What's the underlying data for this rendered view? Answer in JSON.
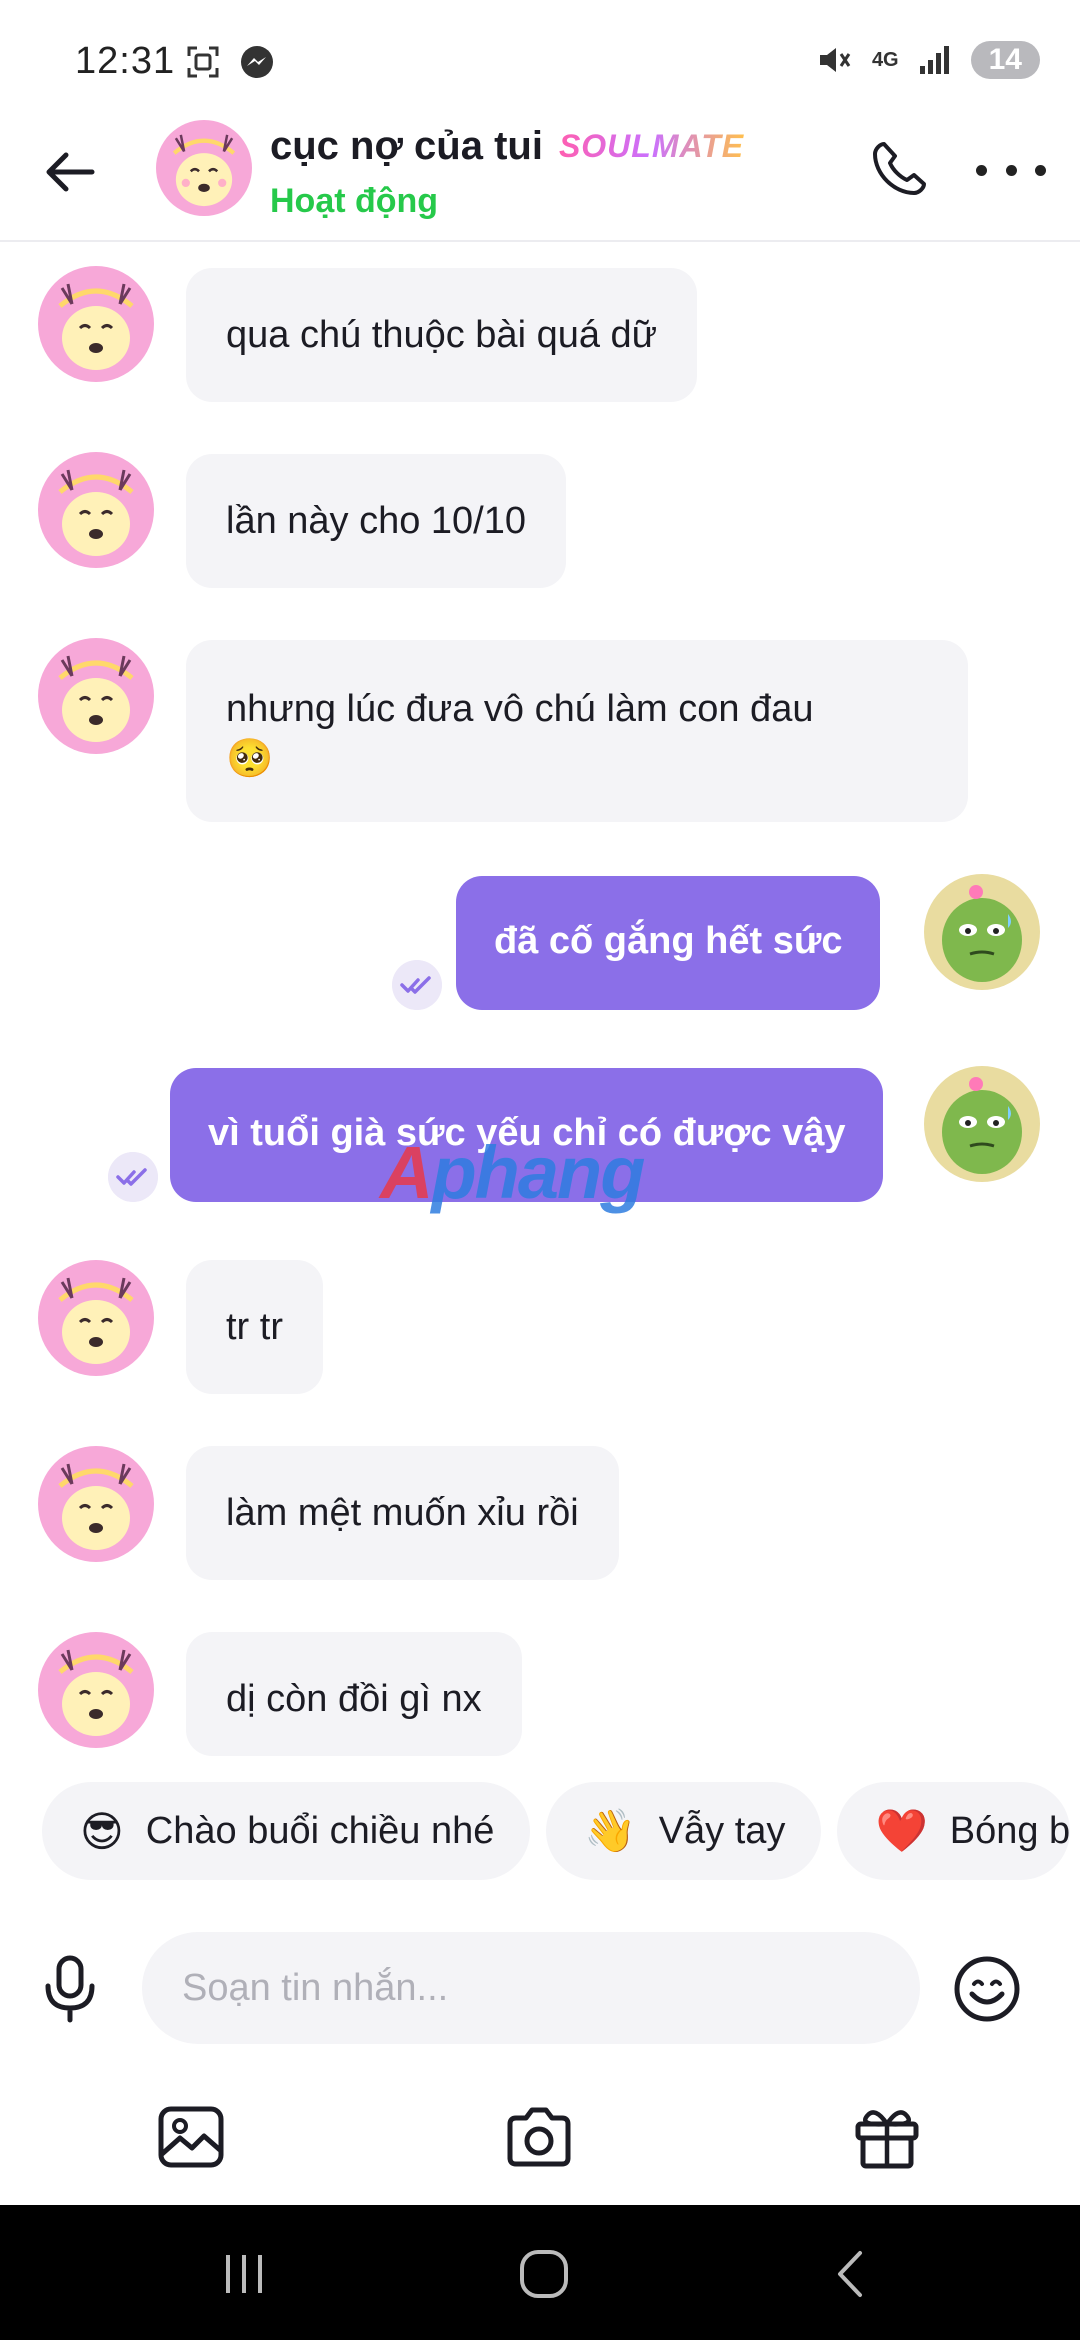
{
  "status_bar": {
    "time": "12:31",
    "network": "4G",
    "battery": "14"
  },
  "header": {
    "name": "cục nợ của tui",
    "tag": "SOULMATE",
    "status": "Hoạt động"
  },
  "messages": [
    {
      "direction": "in",
      "text": "qua chú thuộc bài quá dữ"
    },
    {
      "direction": "in",
      "text": "lần này cho 10/10"
    },
    {
      "direction": "in",
      "text": "nhưng lúc đưa vô chú làm con đau",
      "emoji": "🥺"
    },
    {
      "direction": "out",
      "text": "đã cố gắng hết sức"
    },
    {
      "direction": "out",
      "text": "vì tuổi già sức yếu chỉ có được vậy"
    },
    {
      "direction": "in",
      "text": "tr tr"
    },
    {
      "direction": "in",
      "text": "làm mệt muốn xỉu rồi"
    },
    {
      "direction": "in",
      "text": "dị còn đồi gì nx"
    }
  ],
  "watermark": {
    "part1": "A",
    "part2": "phang"
  },
  "quick_replies": [
    {
      "emoji": "😎",
      "label": "Chào buổi chiều nhé"
    },
    {
      "emoji": "👋",
      "label": "Vẫy tay"
    },
    {
      "emoji": "❤️",
      "label": "Bóng b"
    }
  ],
  "composer": {
    "placeholder": "Soạn tin nhắn..."
  },
  "colors": {
    "outgoing_bubble": "#8b6fe8",
    "incoming_bubble": "#f4f4f7",
    "online_status": "#26c94a"
  }
}
